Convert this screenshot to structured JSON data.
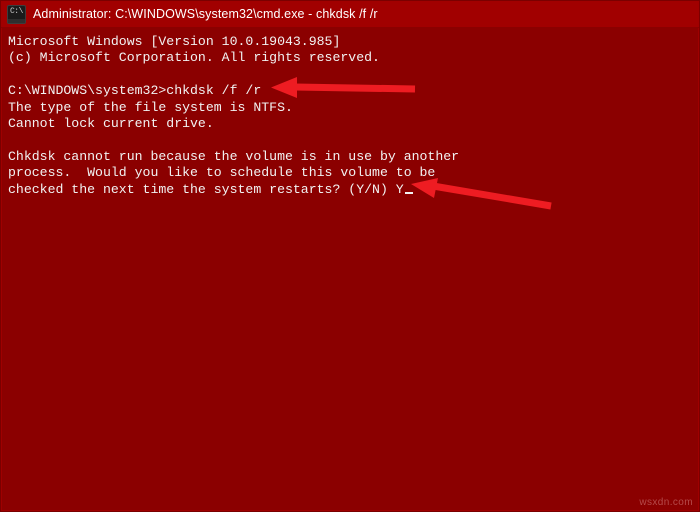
{
  "window": {
    "title": "Administrator: C:\\WINDOWS\\system32\\cmd.exe - chkdsk  /f /r",
    "icon": "cmd-icon",
    "background_color": "#8b0000",
    "titlebar_color": "#a10000",
    "text_color": "#f2f2f2"
  },
  "console": {
    "lines": [
      "Microsoft Windows [Version 10.0.19043.985]",
      "(c) Microsoft Corporation. All rights reserved.",
      "",
      "C:\\WINDOWS\\system32>chkdsk /f /r",
      "The type of the file system is NTFS.",
      "Cannot lock current drive.",
      "",
      "Chkdsk cannot run because the volume is in use by another",
      "process.  Would you like to schedule this volume to be",
      "checked the next time the system restarts? (Y/N) Y"
    ],
    "cursor_after_line_index": 9
  },
  "annotations": {
    "color": "#ee1c22",
    "arrows": [
      {
        "name": "arrow-pointing-to-chkdsk-command",
        "points_to": "C:\\WINDOWS\\system32>chkdsk /f /r"
      },
      {
        "name": "arrow-pointing-to-confirmation-answer",
        "points_to": "(Y/N) Y"
      }
    ]
  },
  "watermark": {
    "text": "wsxdn.com"
  }
}
